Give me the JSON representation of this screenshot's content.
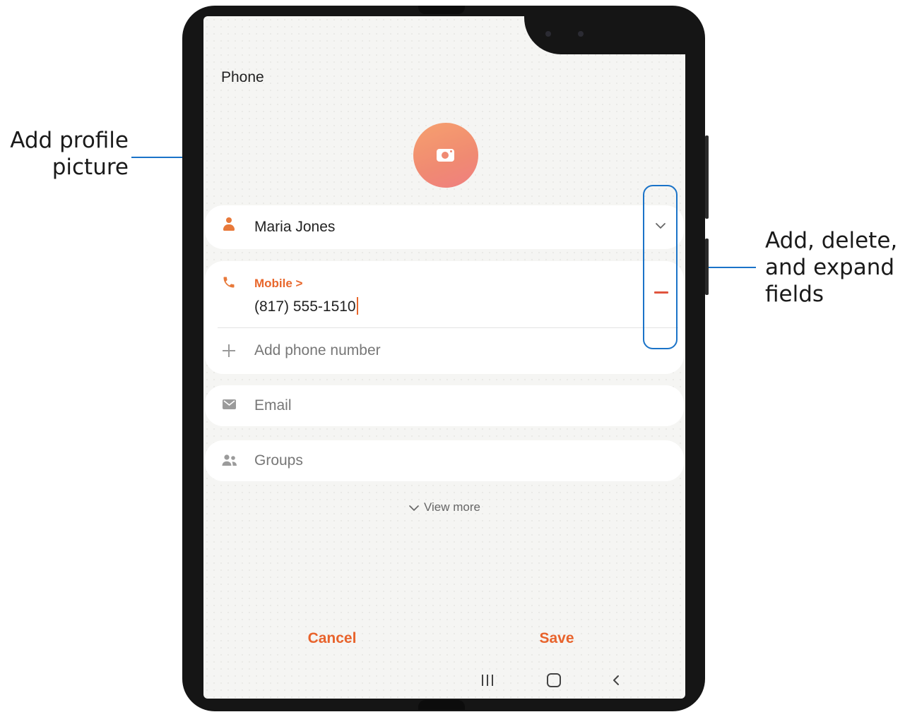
{
  "callouts": {
    "profile_picture": "Add profile picture",
    "fields": "Add, delete, and expand fields"
  },
  "app": {
    "title": "Phone"
  },
  "contact": {
    "name": "Maria Jones",
    "phone_type_label": "Mobile >",
    "phone_number": "(817) 555-1510",
    "add_phone_label": "Add phone number",
    "email_label": "Email",
    "groups_label": "Groups",
    "view_more_label": "View more"
  },
  "actions": {
    "cancel_label": "Cancel",
    "save_label": "Save"
  },
  "icons": {
    "profile": "camera-icon",
    "name": "person-icon",
    "phone": "phone-icon",
    "add": "plus-icon",
    "email": "envelope-icon",
    "groups": "groups-icon",
    "expand": "chevron-down-icon",
    "delete": "minus-icon",
    "nav_recents": "recents-icon",
    "nav_home": "home-icon",
    "nav_back": "back-icon"
  },
  "colors": {
    "accent": "#e8632c",
    "callout_line": "#1a73c8",
    "delete": "#e0553e"
  }
}
